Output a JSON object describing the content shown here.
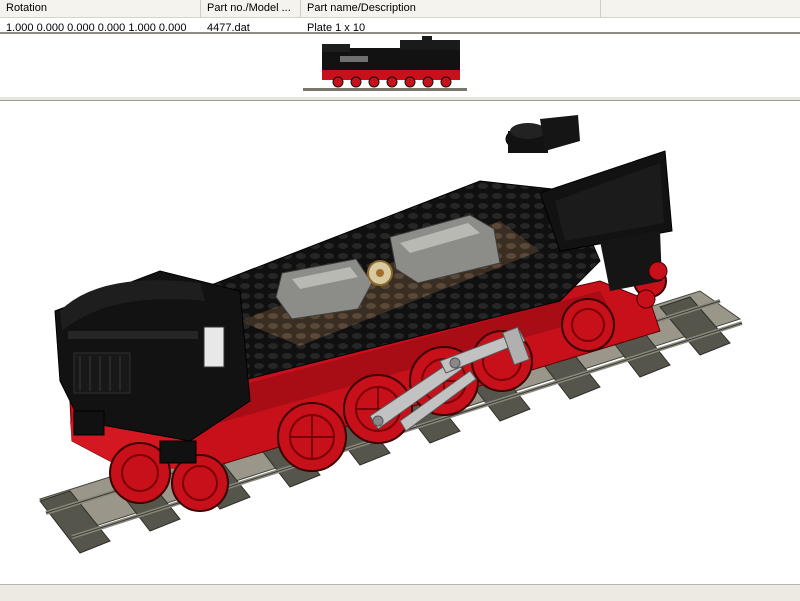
{
  "parts_list": {
    "columns": [
      "Rotation",
      "Part no./Model ...",
      "Part name/Description",
      ""
    ],
    "rows": [
      {
        "rotation": "1.000 0.000 0.000 0.000 1.000 0.000",
        "part_no": "4477.dat",
        "part_name": "Plate 1 x 10"
      }
    ]
  },
  "colors": {
    "body_black": "#121212",
    "frame_red": "#c8101a",
    "rail_gray": "#6e6b5e",
    "sleeper_gray": "#4a4a40",
    "window_gray": "#8a8a86",
    "rod_gray": "#b5b5b5"
  }
}
